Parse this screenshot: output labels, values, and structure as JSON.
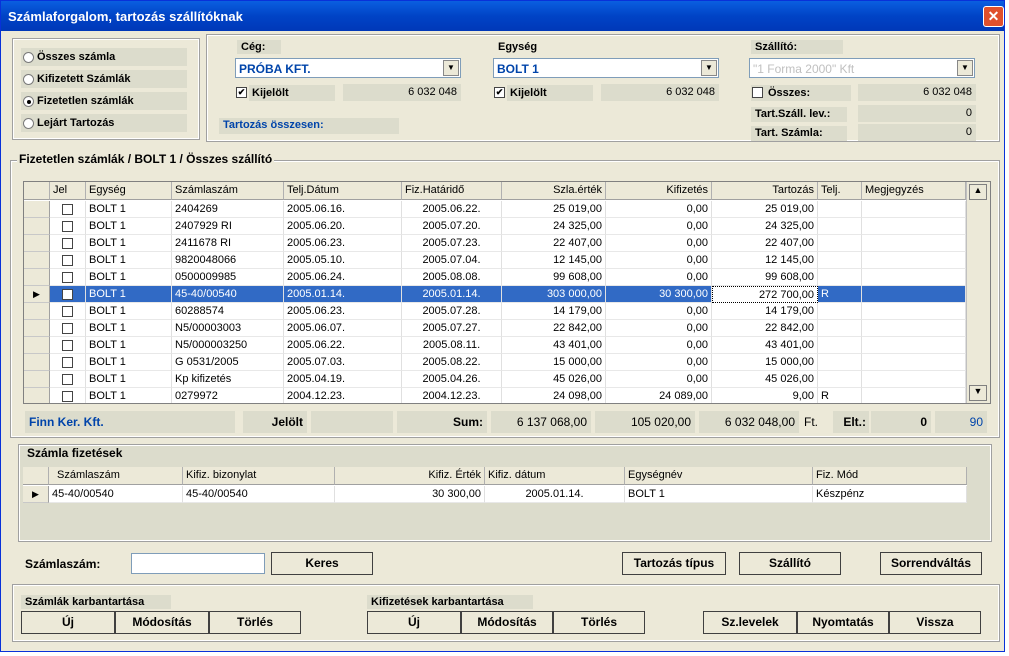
{
  "window": {
    "title": "Számlaforgalom, tartozás szállítóknak",
    "close": "✕"
  },
  "filter": {
    "radios": [
      {
        "label": "Összes számla",
        "selected": false
      },
      {
        "label": "Kifizetett Számlák",
        "selected": false
      },
      {
        "label": "Fizetetlen számlák",
        "selected": true
      },
      {
        "label": "Lejárt Tartozás",
        "selected": false
      }
    ]
  },
  "ceg": {
    "label": "Cég:",
    "value": "PRÓBA KFT.",
    "kijelolt_label": "Kijelölt",
    "kijelolt_checked": true,
    "amount": "6 032 048"
  },
  "egyseg": {
    "label": "Egység",
    "value": "BOLT 1",
    "kijelolt_label": "Kijelölt",
    "kijelolt_checked": true,
    "amount": "6 032 048"
  },
  "szallito": {
    "label": "Szállító:",
    "value": "\"1 Forma 2000\" Kft",
    "osszes_label": "Összes:",
    "osszes_checked": false,
    "osszes_value": "6 032 048",
    "tart_szall_label": "Tart.Száll. lev.:",
    "tart_szall_value": "0",
    "tart_szamla_label": "Tart. Számla:",
    "tart_szamla_value": "0"
  },
  "tartozas_osszesen": "Tartozás összesen:",
  "main_section_title": "Fizetetlen számlák  / BOLT 1  / Összes szállító",
  "invoices": {
    "columns": [
      "Jel",
      "Egység",
      "Számlaszám",
      "Telj.Dátum",
      "Fiz.Határidő",
      "Szla.érték",
      "Kifizetés",
      "Tartozás",
      "Telj.",
      "Megjegyzés"
    ],
    "rows": [
      {
        "egyseg": "BOLT 1",
        "szamla": "2404269",
        "telj": "2005.06.16.",
        "hatarido": "2005.06.22.",
        "ertek": "25 019,00",
        "kifiz": "0,00",
        "tartozas": "25 019,00",
        "tj": "",
        "megj": "",
        "sel": false
      },
      {
        "egyseg": "BOLT 1",
        "szamla": "2407929 RI",
        "telj": "2005.06.20.",
        "hatarido": "2005.07.20.",
        "ertek": "24 325,00",
        "kifiz": "0,00",
        "tartozas": "24 325,00",
        "tj": "",
        "megj": "",
        "sel": false
      },
      {
        "egyseg": "BOLT 1",
        "szamla": "2411678 RI",
        "telj": "2005.06.23.",
        "hatarido": "2005.07.23.",
        "ertek": "22 407,00",
        "kifiz": "0,00",
        "tartozas": "22 407,00",
        "tj": "",
        "megj": "",
        "sel": false
      },
      {
        "egyseg": "BOLT 1",
        "szamla": "9820048066",
        "telj": "2005.05.10.",
        "hatarido": "2005.07.04.",
        "ertek": "12 145,00",
        "kifiz": "0,00",
        "tartozas": "12 145,00",
        "tj": "",
        "megj": "",
        "sel": false
      },
      {
        "egyseg": "BOLT 1",
        "szamla": "0500009985",
        "telj": "2005.06.24.",
        "hatarido": "2005.08.08.",
        "ertek": "99 608,00",
        "kifiz": "0,00",
        "tartozas": "99 608,00",
        "tj": "",
        "megj": "",
        "sel": false
      },
      {
        "egyseg": "BOLT 1",
        "szamla": "45-40/00540",
        "telj": "2005.01.14.",
        "hatarido": "2005.01.14.",
        "ertek": "303 000,00",
        "kifiz": "30 300,00",
        "tartozas": "272 700,00",
        "tj": "R",
        "megj": "",
        "sel": true
      },
      {
        "egyseg": "BOLT 1",
        "szamla": "60288574",
        "telj": "2005.06.23.",
        "hatarido": "2005.07.28.",
        "ertek": "14 179,00",
        "kifiz": "0,00",
        "tartozas": "14 179,00",
        "tj": "",
        "megj": "",
        "sel": false
      },
      {
        "egyseg": "BOLT 1",
        "szamla": "N5/00003003",
        "telj": "2005.06.07.",
        "hatarido": "2005.07.27.",
        "ertek": "22 842,00",
        "kifiz": "0,00",
        "tartozas": "22 842,00",
        "tj": "",
        "megj": "",
        "sel": false
      },
      {
        "egyseg": "BOLT 1",
        "szamla": "N5/000003250",
        "telj": "2005.06.22.",
        "hatarido": "2005.08.11.",
        "ertek": "43 401,00",
        "kifiz": "0,00",
        "tartozas": "43 401,00",
        "tj": "",
        "megj": "",
        "sel": false
      },
      {
        "egyseg": "BOLT 1",
        "szamla": "G 0531/2005",
        "telj": "2005.07.03.",
        "hatarido": "2005.08.22.",
        "ertek": "15 000,00",
        "kifiz": "0,00",
        "tartozas": "15 000,00",
        "tj": "",
        "megj": "",
        "sel": false
      },
      {
        "egyseg": "BOLT 1",
        "szamla": "Kp kifizetés",
        "telj": "2005.04.19.",
        "hatarido": "2005.04.26.",
        "ertek": "45 026,00",
        "kifiz": "0,00",
        "tartozas": "45 026,00",
        "tj": "",
        "megj": "",
        "sel": false
      },
      {
        "egyseg": "BOLT 1",
        "szamla": "0279972",
        "telj": "2004.12.23.",
        "hatarido": "2004.12.23.",
        "ertek": "24 098,00",
        "kifiz": "24 089,00",
        "tartozas": "9,00",
        "tj": "R",
        "megj": "",
        "sel": false
      }
    ]
  },
  "summary": {
    "supplier": "Finn Ker. Kft.",
    "jelolt_label": "Jelölt",
    "sum_label": "Sum:",
    "sum_ertek": "6 137 068,00",
    "sum_kifiz": "105 020,00",
    "sum_tartozas": "6 032 048,00",
    "ft": "Ft.",
    "elt_label": "Elt.:",
    "elt_value": "0",
    "count": "90"
  },
  "payments": {
    "title": "Számla fizetések",
    "columns": [
      "Számlaszám",
      "Kifiz. bizonylat",
      "Kifiz. Érték",
      "Kifiz. dátum",
      "Egységnév",
      "Fiz. Mód"
    ],
    "rows": [
      {
        "szamla": "45-40/00540",
        "bizonylat": "45-40/00540",
        "ertek": "30 300,00",
        "datum": "2005.01.14.",
        "egyseg": "BOLT 1",
        "mod": "Készpénz"
      }
    ]
  },
  "search": {
    "label": "Számlaszám:",
    "value": "",
    "button": "Keres"
  },
  "buttons": {
    "tartozas_tipus": "Tartozás típus",
    "szallito": "Szállító",
    "sorrendvaltas": "Sorrendváltás",
    "sz_levelek": "Sz.levelek",
    "nyomtatas": "Nyomtatás",
    "vissza": "Vissza"
  },
  "szamlak_karb": {
    "title": "Számlák karbantartása",
    "uj": "Új",
    "modositas": "Módosítás",
    "torles": "Törlés"
  },
  "kifiz_karb": {
    "title": "Kifizetések karbantartása",
    "uj": "Új",
    "modositas": "Módosítás",
    "torles": "Törlés"
  }
}
